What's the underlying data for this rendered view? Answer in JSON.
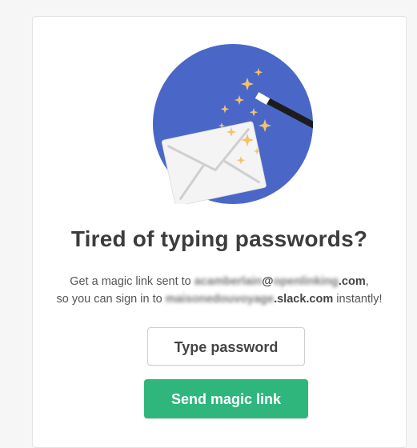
{
  "colors": {
    "circle": "#4a67c8",
    "sparkle": "#f5c26b",
    "button_primary": "#2eb67d",
    "headline": "#3c3c3c"
  },
  "illustration": {
    "icons": [
      "magic-wand-icon",
      "envelope-icon",
      "sparkle-icon"
    ]
  },
  "headline": "Tired of typing passwords?",
  "description": {
    "line1_prefix": "Get a magic link sent to ",
    "email_local_blurred": "acamberlain",
    "email_at": "@",
    "email_domain_blurred": "openlinking",
    "email_tld": ".com",
    "line1_suffix": ",",
    "line2_prefix": "so you can sign in to ",
    "workspace_blurred": "maisonedouvoyage",
    "workspace_suffix": ".slack.com",
    "line2_suffix": " instantly!"
  },
  "buttons": {
    "type_password": "Type password",
    "send_magic_link": "Send magic link"
  }
}
